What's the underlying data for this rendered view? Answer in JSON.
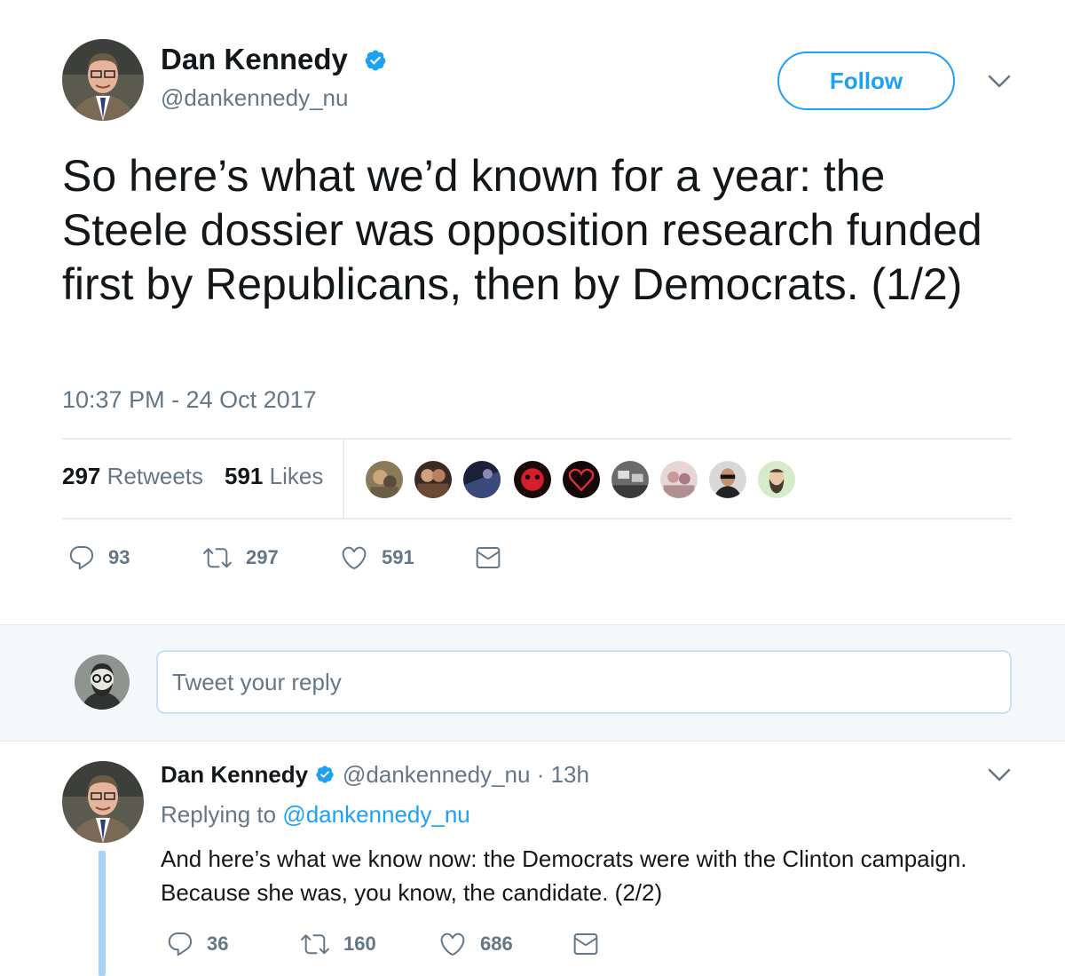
{
  "main_tweet": {
    "author_name": "Dan Kennedy",
    "author_handle": "@dankennedy_nu",
    "follow_label": "Follow",
    "text": "So here’s what we’d known for a year: the Steele dossier was opposition research funded first by Republicans, then by Democrats. (1/2)",
    "timestamp": "10:37 PM - 24 Oct 2017",
    "retweets_count": "297",
    "retweets_label": "Retweets",
    "likes_count": "591",
    "likes_label": "Likes",
    "actions": {
      "replies": "93",
      "retweets": "297",
      "likes": "591"
    }
  },
  "reply_box": {
    "placeholder": "Tweet your reply"
  },
  "reply_tweet": {
    "author_name": "Dan Kennedy",
    "author_handle": "@dankennedy_nu",
    "separator": "·",
    "time_ago": "13h",
    "replying_prefix": "Replying to",
    "replying_to": "@dankennedy_nu",
    "text": "And here’s what we know now: the Democrats were with the Clinton campaign. Because she was, you know, the candidate. (2/2)",
    "actions": {
      "replies": "36",
      "retweets": "160",
      "likes": "686"
    }
  },
  "colors": {
    "accent": "#1da1f2",
    "text_primary": "#14171a",
    "text_secondary": "#657786",
    "divider": "#e6ecf0",
    "reply_bg": "#f5f8fa",
    "thread_line": "#aad4f5"
  },
  "icons": [
    "verified-badge-icon",
    "chevron-down-icon",
    "reply-icon",
    "retweet-icon",
    "like-heart-icon",
    "direct-message-icon"
  ]
}
